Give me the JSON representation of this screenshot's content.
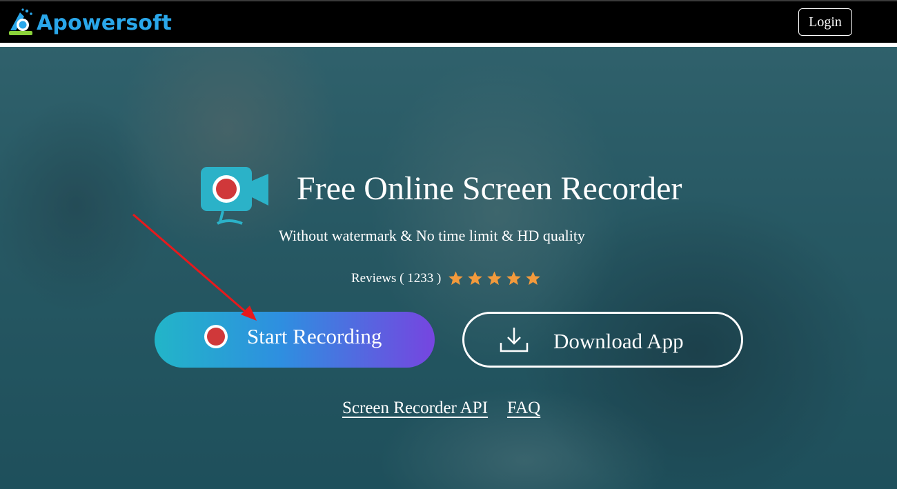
{
  "header": {
    "brand": "Apowersoft",
    "login_label": "Login"
  },
  "hero": {
    "title": "Free Online Screen Recorder",
    "subtitle": "Without watermark & No time limit & HD quality",
    "reviews_text": "Reviews ( 1233 )",
    "rating_stars": 5,
    "start_button_label": "Start Recording",
    "download_button_label": "Download App",
    "links": [
      "Screen Recorder API",
      "FAQ"
    ]
  },
  "colors": {
    "brand_blue": "#2aa7ea",
    "star_orange": "#f39a3c",
    "record_red": "#d0383a",
    "camera_teal": "#2bb2c8",
    "annotation_arrow": "#e8191c"
  },
  "icons": [
    "apowersoft-logo-icon",
    "camera-record-icon",
    "star-icon",
    "record-dot-icon",
    "download-icon"
  ]
}
